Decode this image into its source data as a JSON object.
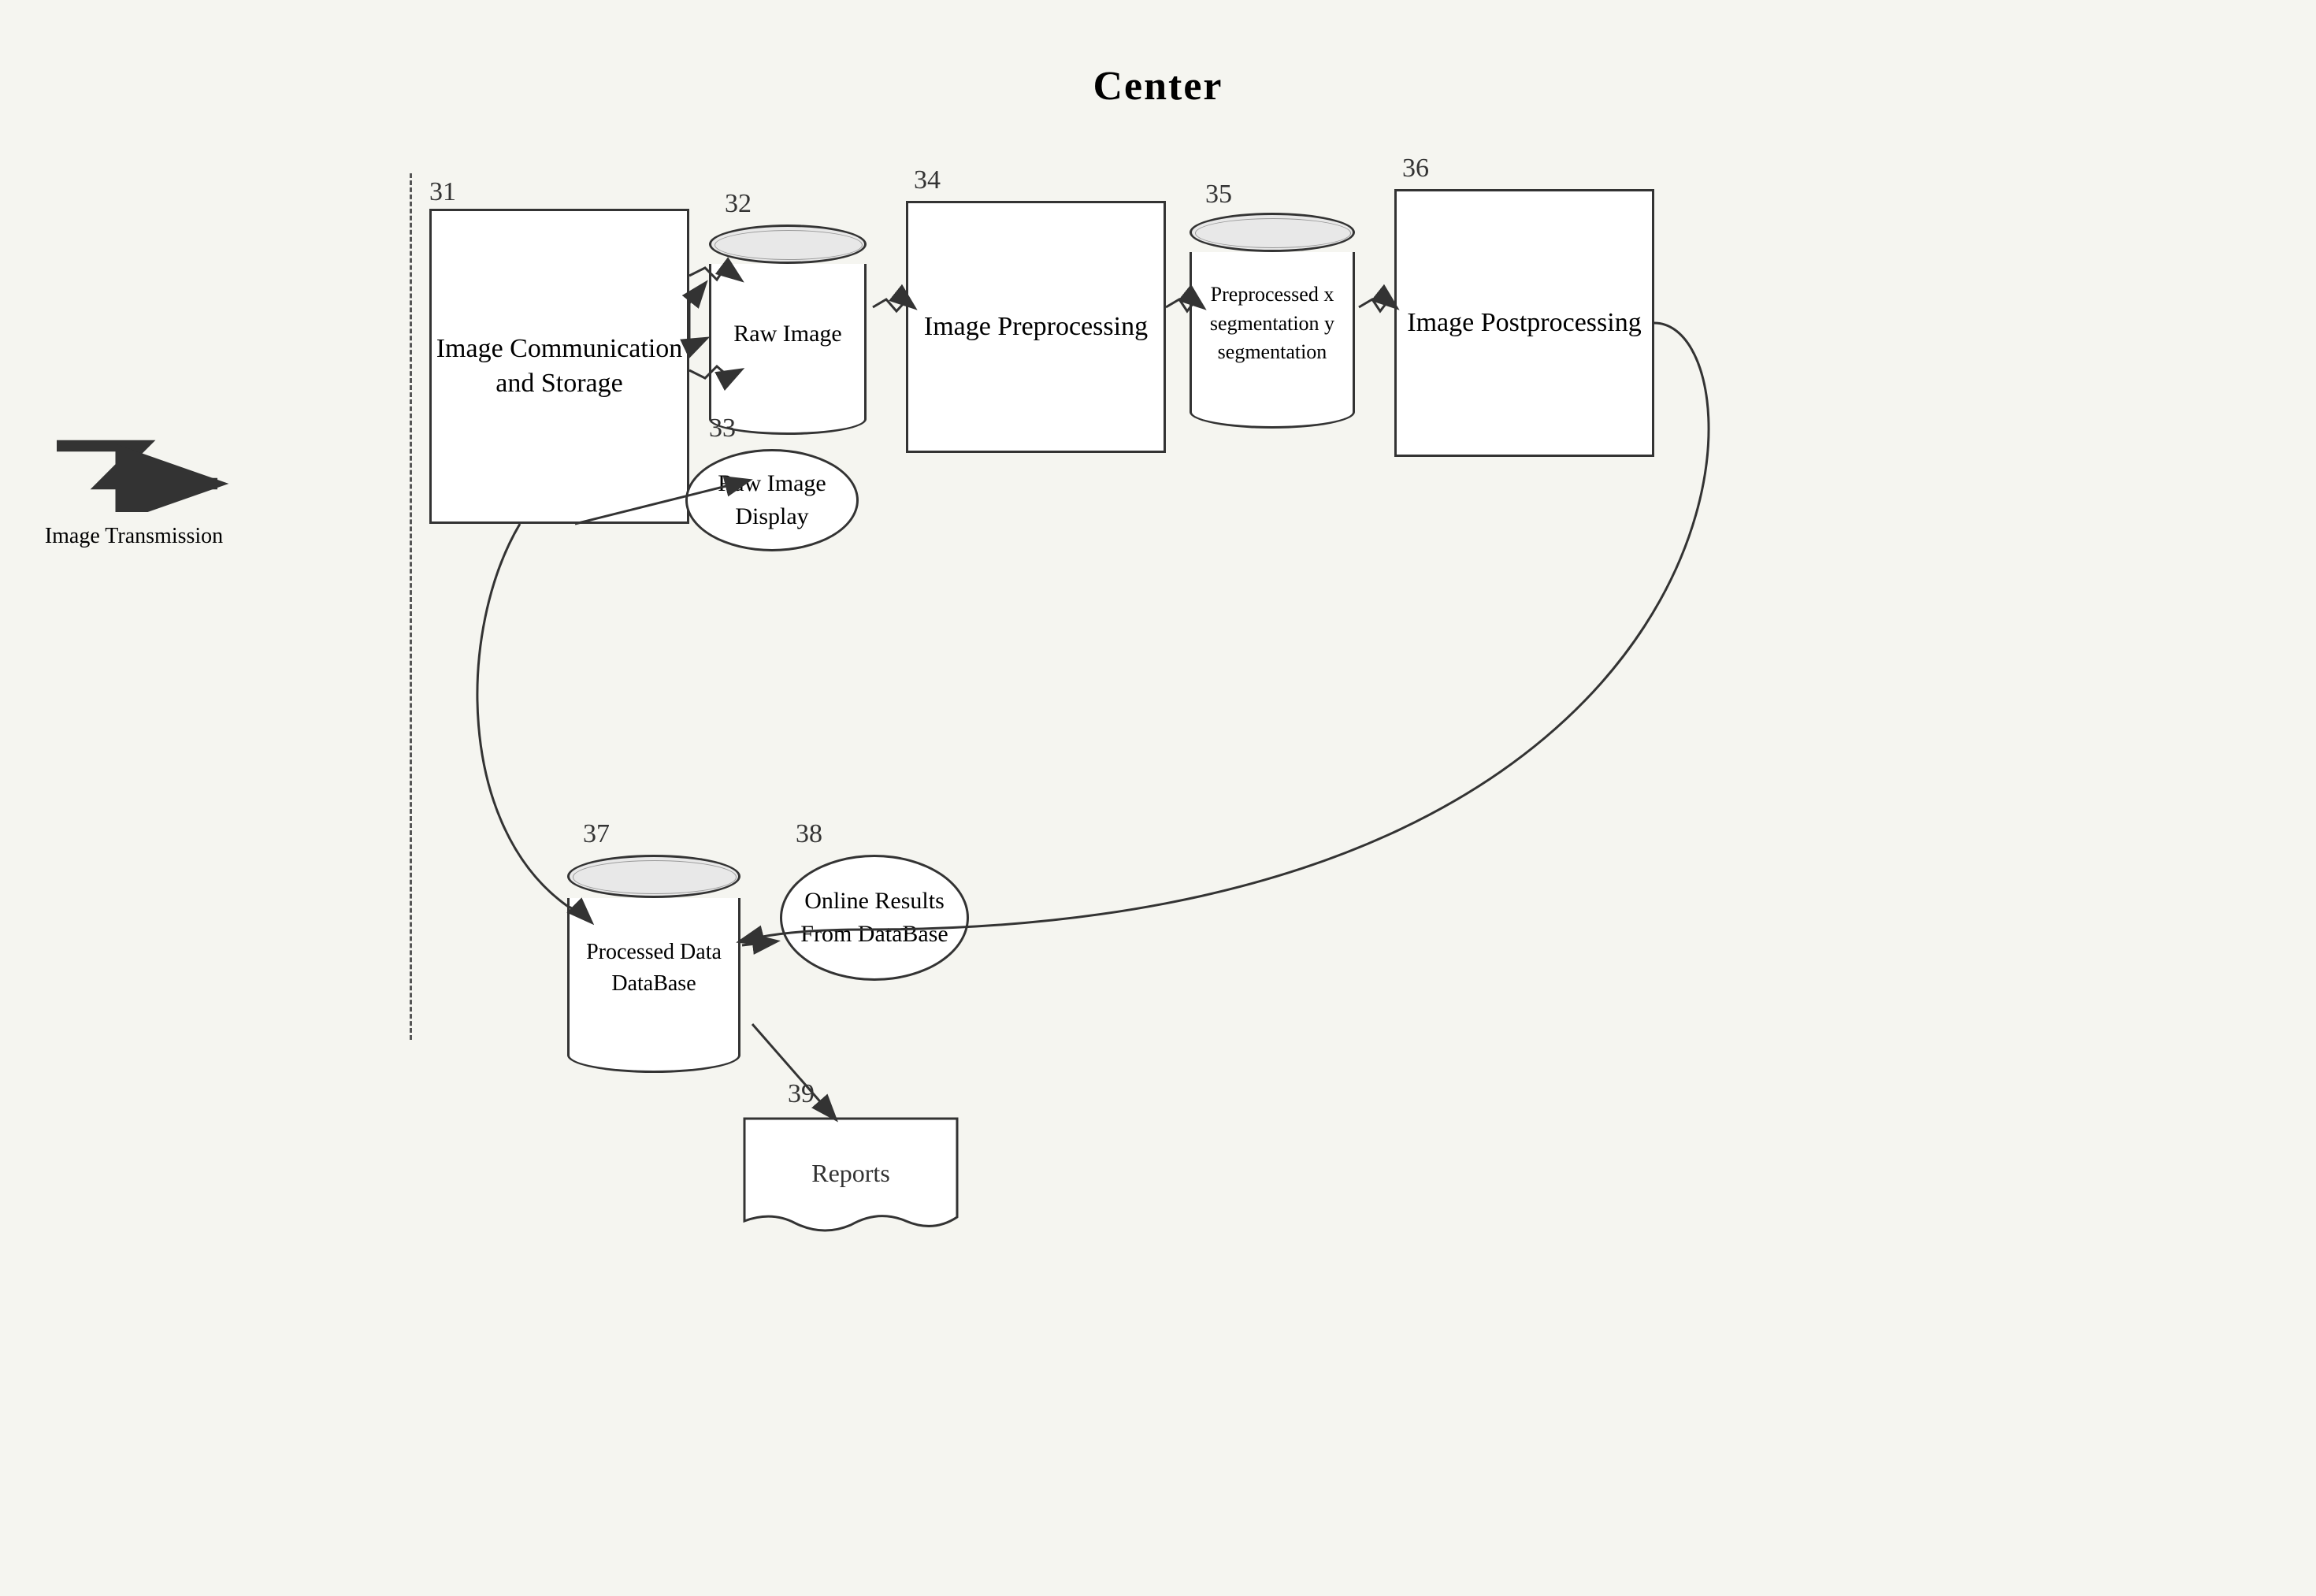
{
  "title": "Center",
  "nodes": {
    "ref31": "31",
    "ref32": "32",
    "ref33": "33",
    "ref34": "34",
    "ref35": "35",
    "ref36": "36",
    "ref37": "37",
    "ref38": "38",
    "ref39": "39"
  },
  "labels": {
    "imageTransmission": "Image Transmission",
    "imageCommunication": "Image Communication and Storage",
    "rawImage": "Raw Image",
    "rawImageDisplay": "Raw Image Display",
    "imagePreprocessing": "Image Preprocessing",
    "preprocessed": "Preprocessed x segmentation y segmentation",
    "imagePostprocessing": "Image Postprocessing",
    "processedDataDB": "Processed Data DataBase",
    "onlineResults": "Online Results From DataBase",
    "reports": "Reports"
  }
}
